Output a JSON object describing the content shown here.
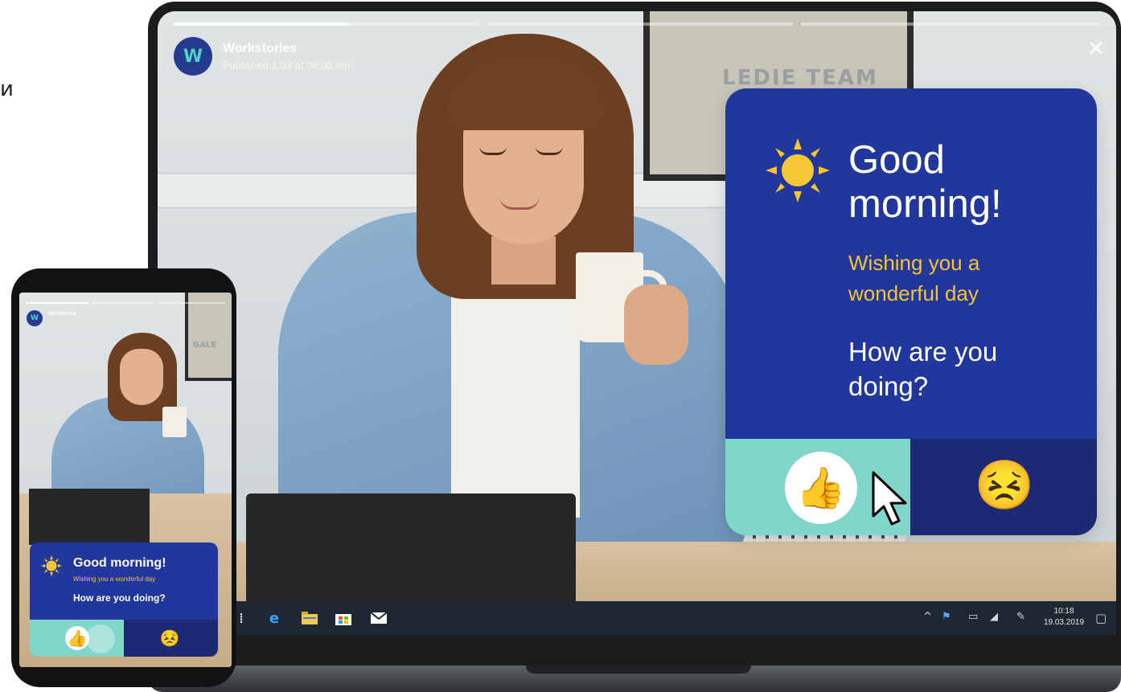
{
  "story": {
    "brand_name": "Workstories",
    "logo_letter": "W",
    "published": "Published 1.03 at 08:00 am",
    "close_glyph": "✕",
    "progress": [
      1.0,
      0.0,
      0.0
    ]
  },
  "card": {
    "greeting": "Good morning!",
    "wish": "Wishing you a wonderful day",
    "question": "How are you doing?",
    "options": [
      {
        "emoji": "👍",
        "name": "thumbs-up"
      },
      {
        "emoji": "😣",
        "name": "persevering-face"
      }
    ]
  },
  "photo": {
    "frame_text": "LEDIE TEAM"
  },
  "taskbar": {
    "time": "10:18",
    "date": "19.03.2019",
    "icons": [
      "task-view-icon",
      "edge-icon",
      "file-explorer-icon",
      "store-icon",
      "mail-icon"
    ],
    "tray_icons": [
      "chevron-up-icon",
      "network-icon",
      "battery-icon",
      "wifi-icon",
      "pen-icon",
      "notification-icon"
    ]
  },
  "phone": {
    "brand_name": "Workstories",
    "greeting": "Good morning!",
    "wish": "Wishing you a wonderful day",
    "question": "How are you doing?",
    "frame_text": "GALE"
  },
  "colors": {
    "card_bg": "#22379b",
    "yes_bg": "#7fd6c9",
    "no_bg": "#1c2a74",
    "wish_text": "#f4c431",
    "logo_bg": "#243b8f"
  }
}
